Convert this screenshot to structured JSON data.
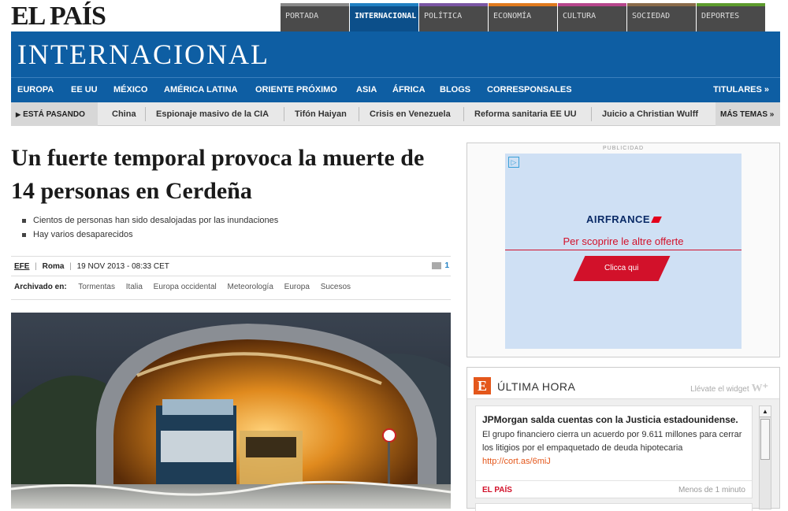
{
  "logo": "EL PAÍS",
  "sections": [
    "PORTADA",
    "INTERNACIONAL",
    "POLÍTICA",
    "ECONOMÍA",
    "CULTURA",
    "SOCIEDAD",
    "DEPORTES"
  ],
  "banner_title": "INTERNACIONAL",
  "subnav": [
    "EUROPA",
    "EE UU",
    "MÉXICO",
    "AMÉRICA LATINA",
    "ORIENTE PRÓXIMO",
    "ASIA",
    "ÁFRICA",
    "BLOGS",
    "CORRESPONSALES"
  ],
  "titulares": "TITULARES »",
  "trending": {
    "label": "ESTÁ PASANDO",
    "items": [
      "China",
      "Espionaje masivo de la CIA",
      "Tifón Haiyan",
      "Crisis en Venezuela",
      "Reforma sanitaria EE UU",
      "Juicio a Christian Wulff"
    ],
    "more": "MÁS TEMAS »"
  },
  "article": {
    "headline": "Un fuerte temporal provoca la muerte de 14 personas en Cerdeña",
    "bullets": [
      "Cientos de personas han sido desalojadas por las inundaciones",
      "Hay varios desaparecidos"
    ],
    "agency": "EFE",
    "city": "Roma",
    "date": "19 NOV 2013 - 08:33 CET",
    "comments": "1",
    "tags_label": "Archivado en:",
    "tags": [
      "Tormentas",
      "Italia",
      "Europa occidental",
      "Meteorología",
      "Europa",
      "Sucesos"
    ]
  },
  "ad": {
    "label": "PUBLICIDAD",
    "brand": "AIRFRANCE",
    "subtitle": "Per scoprire le altre offerte",
    "cta": "Clicca qui"
  },
  "ultima_hora": {
    "title": "ÚLTIMA HORA",
    "widget": "Llévate el widget",
    "news_title": "JPMorgan salda cuentas con la Justicia estadounidense.",
    "news_body": "El grupo financiero cierra un acuerdo por 9.611 millones para cerrar los litigios por el empaquetado de deuda hipotecaria",
    "news_link": "http://cort.as/6miJ",
    "source": "EL PAÍS",
    "time": "Menos de 1 minuto"
  }
}
